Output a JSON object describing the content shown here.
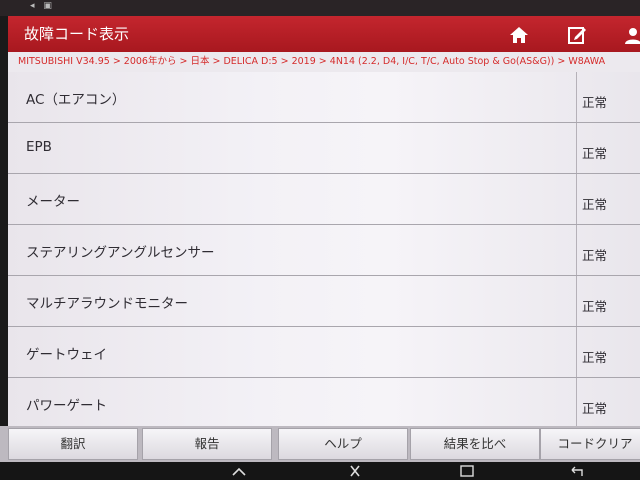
{
  "header": {
    "title": "故障コード表示"
  },
  "breadcrumb": "MITSUBISHI V34.95 > 2006年から > 日本 > DELICA D:5 > 2019 > 4N14 (2.2, D4, I/C, T/C, Auto Stop & Go(AS&G)) > W8AWA",
  "systems": [
    {
      "name": "AC（エアコン）",
      "status": "正常"
    },
    {
      "name": "EPB",
      "status": "正常"
    },
    {
      "name": "メーター",
      "status": "正常"
    },
    {
      "name": "ステアリングアングルセンサー",
      "status": "正常"
    },
    {
      "name": "マルチアラウンドモニター",
      "status": "正常"
    },
    {
      "name": "ゲートウェイ",
      "status": "正常"
    },
    {
      "name": "パワーゲート",
      "status": "正常"
    }
  ],
  "buttons": {
    "translate": "翻訳",
    "report": "報告",
    "help": "ヘルプ",
    "compare": "結果を比べ",
    "clear": "コードクリア"
  },
  "colors": {
    "header": "#b51e25",
    "breadcrumb_text": "#d52b2b"
  },
  "icons": {
    "home": "home-icon",
    "edit": "edit-icon",
    "user": "user-icon"
  }
}
